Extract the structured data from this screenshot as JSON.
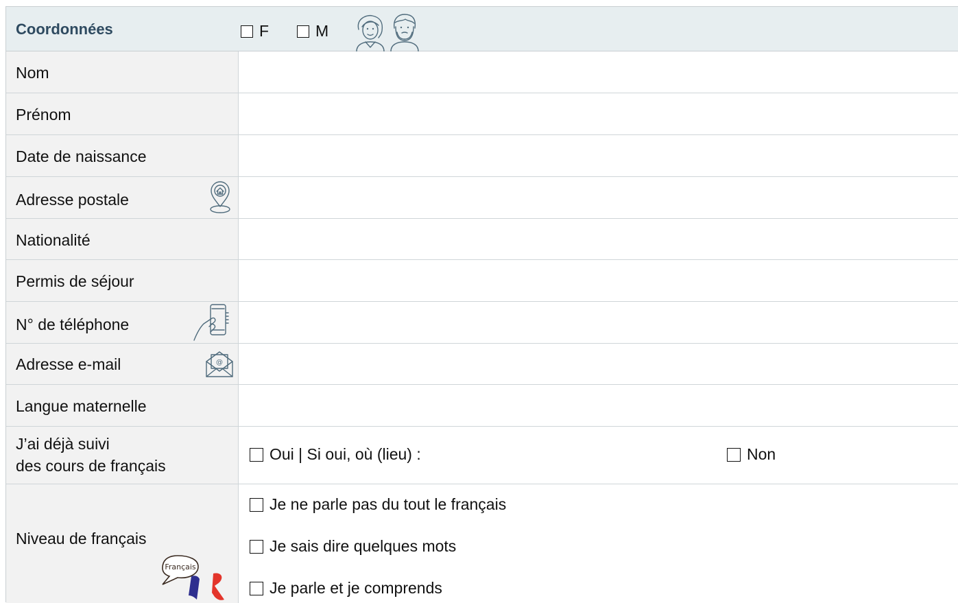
{
  "header": {
    "title": "Coordonnées",
    "gender_f": "F",
    "gender_m": "M",
    "icon": "woman-man-icon"
  },
  "fields": [
    {
      "label": "Nom"
    },
    {
      "label": "Prénom"
    },
    {
      "label": "Date de naissance"
    },
    {
      "label": "Adresse postale",
      "icon": "location-pin-home-icon"
    },
    {
      "label": "Nationalité"
    },
    {
      "label": "Permis de séjour"
    },
    {
      "label": "N° de téléphone",
      "icon": "phone-in-hand-icon"
    },
    {
      "label": "Adresse e-mail",
      "icon": "email-envelope-icon"
    },
    {
      "label": "Langue maternelle"
    }
  ],
  "courses": {
    "label_line1": "J’ai déjà suivi",
    "label_line2": "des cours de français",
    "yes": "Oui | Si oui, où (lieu) :",
    "no": "Non"
  },
  "level": {
    "label": "Niveau de français",
    "bubble_text": "Français",
    "options": [
      "Je ne parle pas du tout le français",
      "Je sais dire quelques mots",
      "Je parle et je comprends"
    ]
  },
  "colors": {
    "header_bg": "#e7eef0",
    "title": "#2e4a60",
    "label_bg": "#f2f2f2",
    "flag_blue": "#2e2f8f",
    "flag_red": "#e3352b"
  }
}
